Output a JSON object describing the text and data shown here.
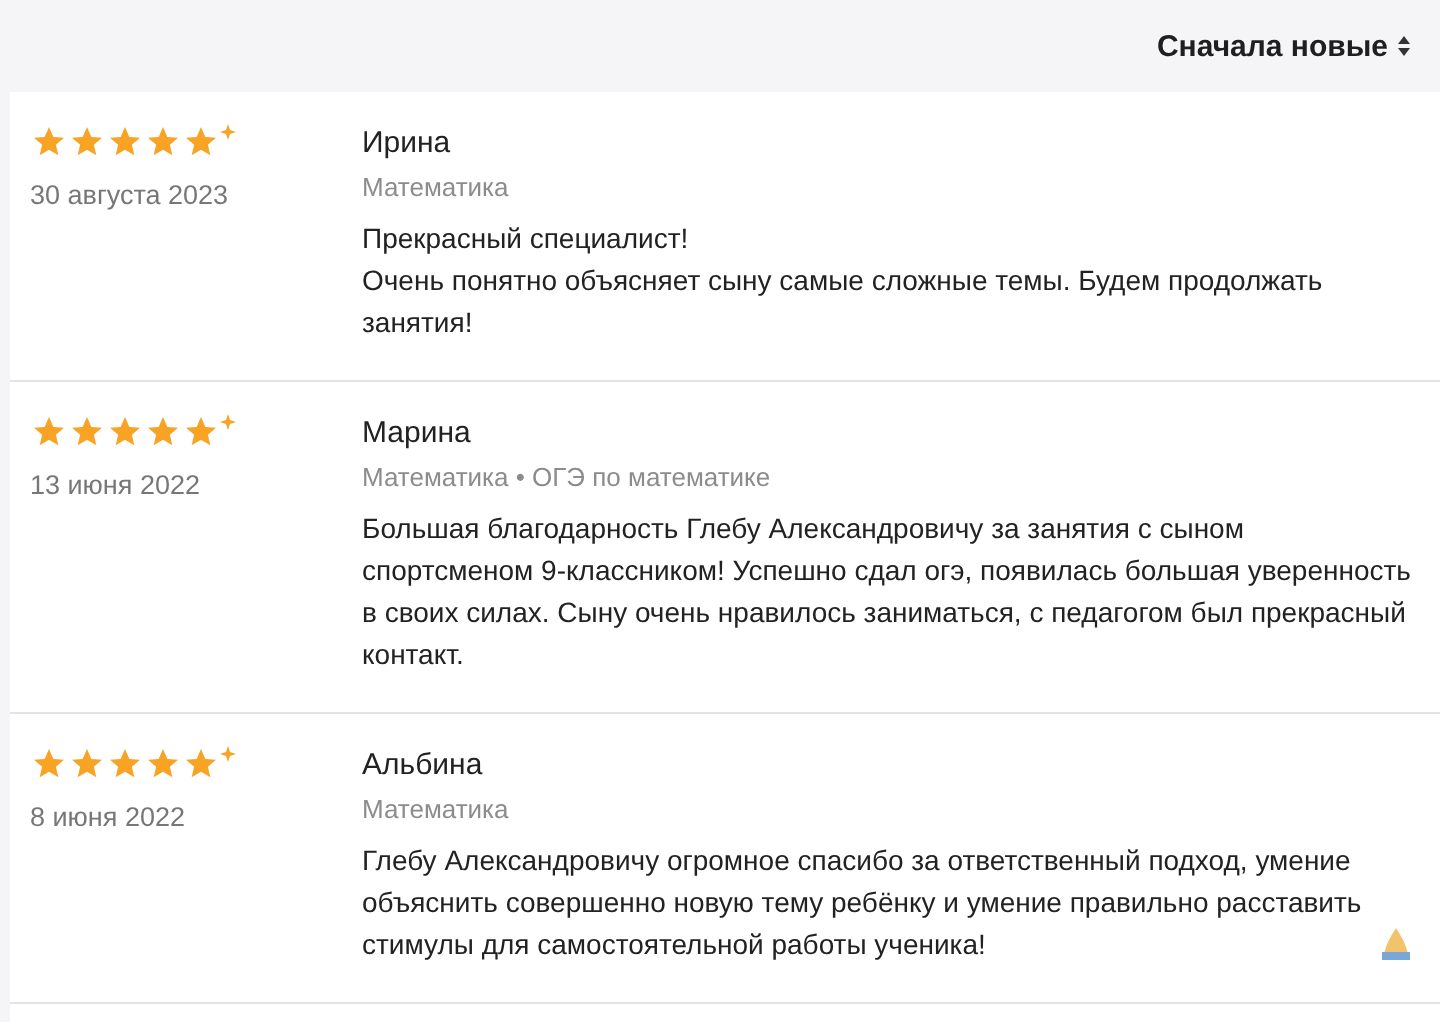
{
  "sort": {
    "label": "Сначала новые"
  },
  "reviews": [
    {
      "stars": 5,
      "date": "30 августа 2023",
      "name": "Ирина",
      "subject": "Математика",
      "paragraphs": [
        "Прекрасный специалист!",
        "Очень понятно объясняет сыну самые сложные темы. Будем продолжать занятия!"
      ],
      "emoji": false
    },
    {
      "stars": 5,
      "date": "13 июня 2022",
      "name": "Марина",
      "subject": "Математика • ОГЭ по математике",
      "paragraphs": [
        "Большая благодарность Глебу Александровичу за занятия с сыном спортсменом 9-классником! Успешно сдал огэ, появилась большая уверенность в своих силах. Сыну очень нравилось заниматься, с педагогом был прекрасный контакт."
      ],
      "emoji": false
    },
    {
      "stars": 5,
      "date": "8 июня 2022",
      "name": "Альбина",
      "subject": "Математика",
      "paragraphs": [
        "Глебу Александровичу огромное спасибо за ответственный подход, умение объяснить совершенно новую тему ребёнку и умение правильно расставить стимулы для самостоятельной работы ученика!"
      ],
      "emoji": true
    }
  ]
}
